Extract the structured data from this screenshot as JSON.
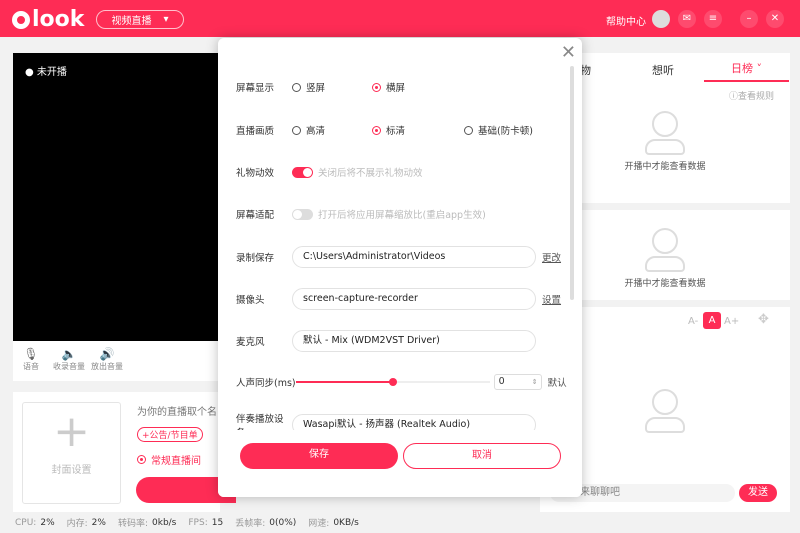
{
  "header": {
    "brand": "look",
    "mode": "视频直播",
    "help": "帮助中心",
    "accent": "#fe2c55"
  },
  "video": {
    "status": "未开播"
  },
  "controls": [
    {
      "icon": "microphone-icon",
      "label": "语音"
    },
    {
      "icon": "speaker-in-icon",
      "label": "收录音量"
    },
    {
      "icon": "speaker-out-icon",
      "label": "放出音量"
    }
  ],
  "room": {
    "cover": "封面设置",
    "title_placeholder": "为你的直播取个名",
    "notice": "+公告/节目单",
    "type": "常规直播间"
  },
  "status": [
    {
      "k": "CPU:",
      "v": "2%"
    },
    {
      "k": "内存:",
      "v": "2%"
    },
    {
      "k": "转码率:",
      "v": "0kb/s"
    },
    {
      "k": "FPS:",
      "v": "15"
    },
    {
      "k": "丢帧率:",
      "v": "0(0%)"
    },
    {
      "k": "网速:",
      "v": "0KB/s"
    }
  ],
  "right": {
    "tabs": [
      "物",
      "想听",
      "日榜"
    ],
    "rules": "查看规则",
    "empty1": "开播中才能查看数据",
    "empty2": "开播中才能查看数据",
    "font_small": "A-",
    "font_mid": "A",
    "font_big": "A+",
    "chat_placeholder": "来聊聊吧",
    "send": "发送"
  },
  "modal": {
    "screen": {
      "label": "屏幕显示",
      "opts": [
        "竖屏",
        "横屏"
      ]
    },
    "quality": {
      "label": "直播画质",
      "opts": [
        "高清",
        "标清",
        "基础(防卡顿)"
      ]
    },
    "gift": {
      "label": "礼物动效",
      "hint": "关闭后将不展示礼物动效",
      "on": true
    },
    "fit": {
      "label": "屏幕适配",
      "hint": "打开后将应用屏幕缩放比(重启app生效)",
      "on": false
    },
    "record": {
      "label": "录制保存",
      "value": "C:\\Users\\Administrator\\Videos",
      "link": "更改"
    },
    "camera": {
      "label": "摄像头",
      "value": "screen-capture-recorder",
      "link": "设置"
    },
    "mic": {
      "label": "麦克风",
      "value": "默认 - Mix (WDM2VST Driver)"
    },
    "sync": {
      "label": "人声同步(ms)",
      "value": "0",
      "reset": "默认",
      "slider_fraction": 0.5
    },
    "accomp": {
      "label": "伴奏播放设备",
      "value": "Wasapi默认 - 扬声器 (Realtek Audio)"
    },
    "save": "保存",
    "cancel": "取消"
  }
}
